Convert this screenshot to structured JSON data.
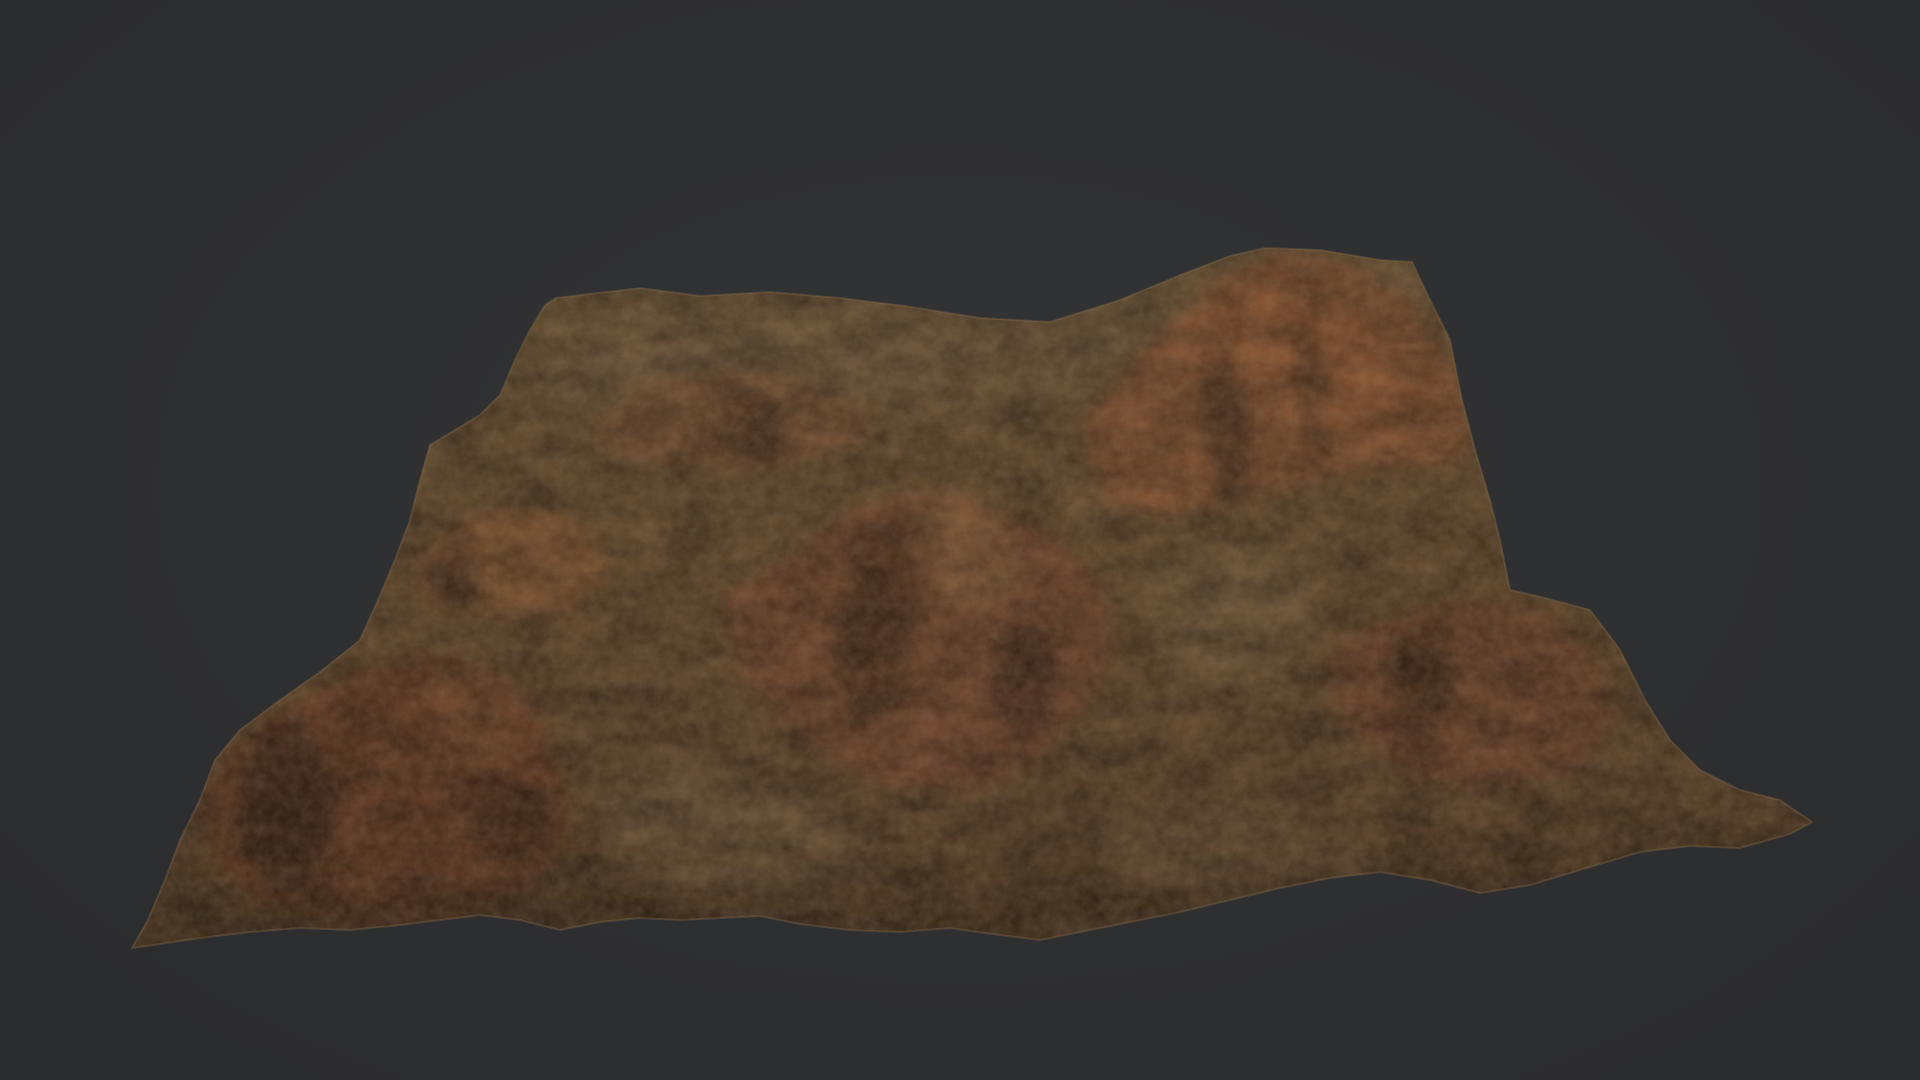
{
  "scene": {
    "background_color": "#2e2f31",
    "subject": "terrain-mesh",
    "palette": {
      "base": "#6b5233",
      "sand": "#7d6442",
      "highlight": "#93704a",
      "rust": "#8a4f2e",
      "shadow": "#3e2a1b",
      "deep_shadow": "#2b1d13"
    }
  }
}
